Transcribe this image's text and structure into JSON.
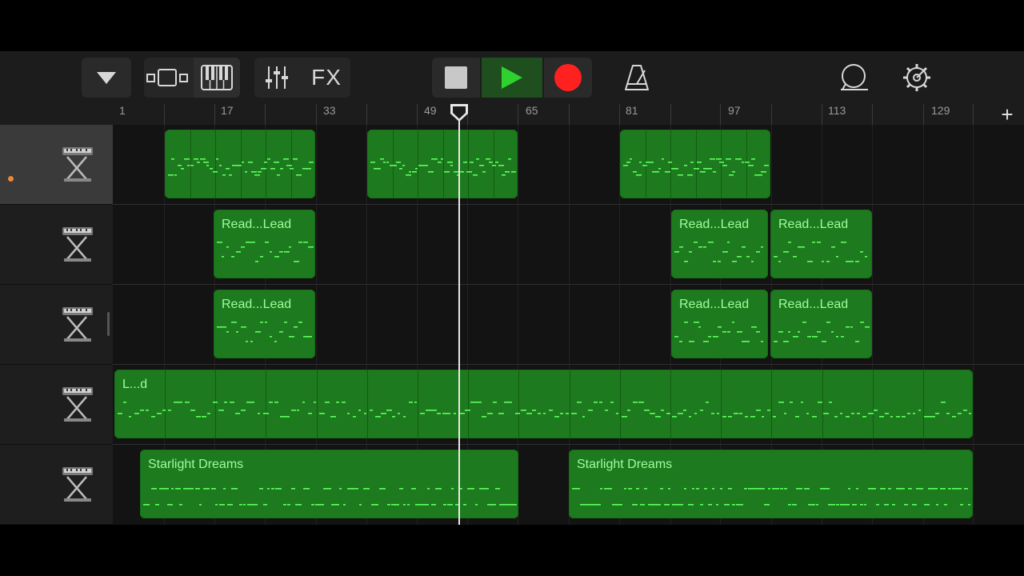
{
  "toolbar": {
    "fx_label": "FX",
    "buttons": [
      "browser-dropdown",
      "tracks-view",
      "keyboard-view",
      "mixer",
      "fx",
      "stop",
      "play",
      "record",
      "metronome",
      "loop",
      "settings"
    ]
  },
  "ruler": {
    "bar_labels": [
      "1",
      "17",
      "33",
      "49",
      "65",
      "81",
      "97",
      "113",
      "129"
    ],
    "add_section": "+"
  },
  "tracks": [
    {
      "instrument": "keyboard-stand-icon",
      "selected": true
    },
    {
      "instrument": "keyboard-stand-icon",
      "selected": false
    },
    {
      "instrument": "keyboard-stand-icon",
      "selected": false
    },
    {
      "instrument": "keyboard-stand-icon",
      "selected": false
    },
    {
      "instrument": "keyboard-stand-icon",
      "selected": false
    }
  ],
  "regions": {
    "t1": [
      "",
      "",
      ""
    ],
    "t2": [
      "Read...Lead",
      "Read...Lead",
      "Read...Lead"
    ],
    "t3": [
      "Read...Lead",
      "Read...Lead",
      "Read...Lead"
    ],
    "t4": [
      "L...d"
    ],
    "t5": [
      "Starlight Dreams",
      "Starlight Dreams"
    ]
  },
  "colors": {
    "region": "#1e7a1e",
    "note": "#5dff5d",
    "play": "#2fd12f",
    "record": "#ff2020",
    "selected_dot": "#e8893a"
  }
}
